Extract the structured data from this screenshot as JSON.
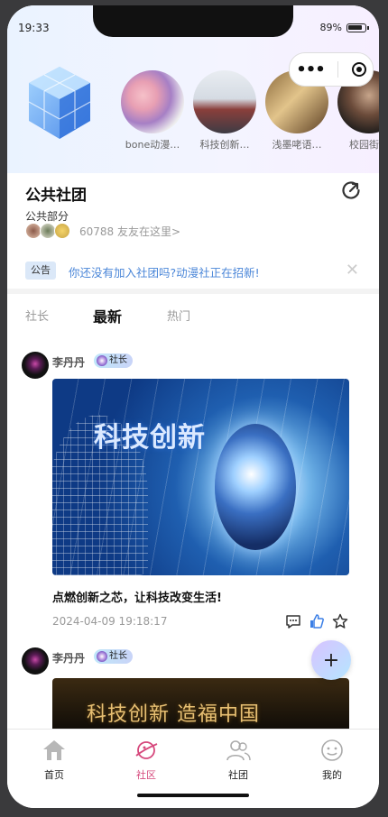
{
  "status": {
    "time": "19:33",
    "battery": "89%"
  },
  "clubs": [
    {
      "name": "bone动漫…"
    },
    {
      "name": "科技创新…"
    },
    {
      "name": "浅墨咾语…"
    },
    {
      "name": "校园街舞"
    }
  ],
  "club_info": {
    "title": "公共社团",
    "subtitle": "公共部分",
    "member_text": "60788 友友在这里>"
  },
  "notice": {
    "tag": "公告",
    "text": "你还没有加入社团吗?动漫社正在招新!",
    "close": "✕"
  },
  "tabs": [
    {
      "label": "社长"
    },
    {
      "label": "最新"
    },
    {
      "label": "热门"
    }
  ],
  "posts": [
    {
      "author": "李丹丹",
      "badge": "社长",
      "image_text": "科技创新",
      "caption": "点燃创新之芯，让科技改变生活!",
      "time": "2024-04-09 19:18:17"
    },
    {
      "author": "李丹丹",
      "badge": "社长",
      "image_text": "科技创新 造福中国"
    }
  ],
  "fab": {
    "label": "+"
  },
  "tabbar": [
    {
      "label": "首页"
    },
    {
      "label": "社区"
    },
    {
      "label": "社团"
    },
    {
      "label": "我的"
    }
  ],
  "colors": {
    "accent": "#d6487c",
    "notice_text": "#4a86d8",
    "header_bg": "#eaf3ff"
  }
}
